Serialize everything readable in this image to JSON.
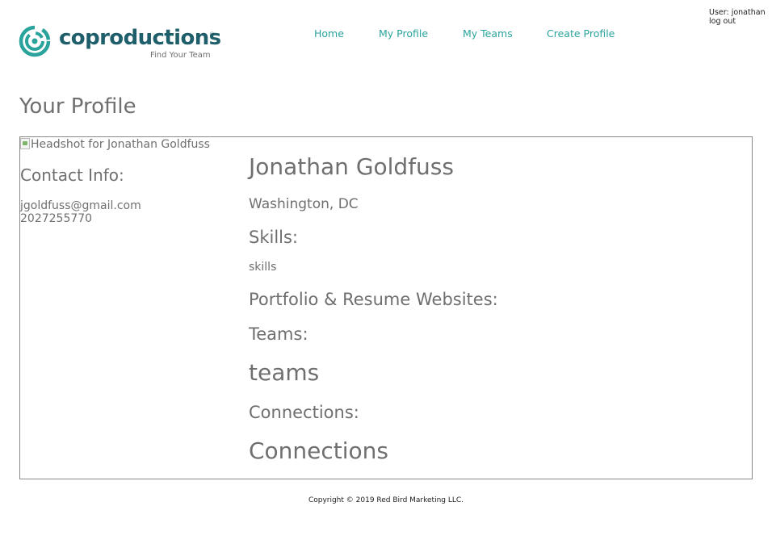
{
  "header": {
    "logo": {
      "wordmark": "coproductions",
      "registered": "®",
      "tagline": "Find Your Team",
      "brand_color": "#1f5f6b",
      "icon_color": "#2aa39c",
      "icon": "concentric-rings-icon"
    },
    "nav": [
      {
        "label": "Home"
      },
      {
        "label": "My Profile"
      },
      {
        "label": "My Teams"
      },
      {
        "label": "Create Profile"
      }
    ],
    "nav_color": "#2aa39c",
    "user": {
      "label": "User: jonathan",
      "logout": "log out"
    }
  },
  "page": {
    "title": "Your Profile"
  },
  "profile": {
    "headshot_alt": "Headshot for Jonathan Goldfuss",
    "headshot_icon": "broken-image-icon",
    "contact": {
      "heading": "Contact Info:",
      "email": "jgoldfuss@gmail.com",
      "phone": "2027255770"
    },
    "name": "Jonathan Goldfuss",
    "location": "Washington, DC",
    "skills_heading": "Skills:",
    "skills": "skills",
    "portfolio_heading": "Portfolio & Resume Websites:",
    "teams_heading": "Teams:",
    "teams": "teams",
    "connections_heading": "Connections:",
    "connections": "Connections"
  },
  "footer": {
    "copyright": "Copyright © 2019 Red Bird Marketing LLC."
  }
}
